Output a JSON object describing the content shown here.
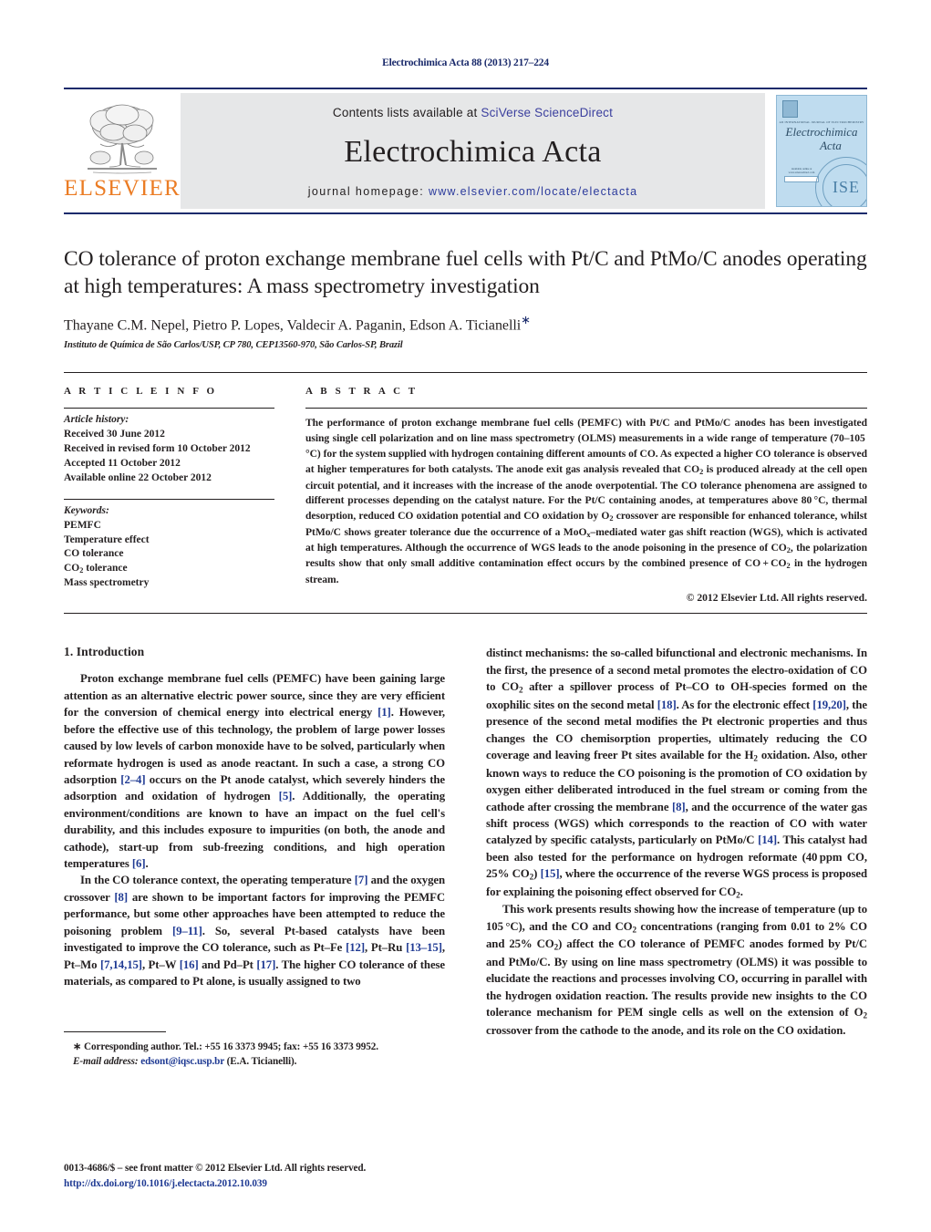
{
  "running_head": "Electrochimica Acta 88 (2013) 217–224",
  "masthead": {
    "publisher_name": "ELSEVIER",
    "contents_prefix": "Contents lists available at ",
    "contents_link": "SciVerse ScienceDirect",
    "journal_title": "Electrochimica Acta",
    "homepage_label": "journal homepage:",
    "homepage_url": "www.elsevier.com/locate/electacta",
    "cover": {
      "kicker": "AN INTERNATIONAL JOURNAL OF ELECTROCHEMISTRY",
      "title_line1": "Electrochimica",
      "title_line2": "Acta",
      "sciencedirect_caption": "Available online at www.sciencedirect.com",
      "sciencedirect_label": "ScienceDirect",
      "seal_text": "ISE"
    },
    "link_color": "#3b3f9e",
    "rule_color": "#1a2a6b",
    "elsevier_orange": "#eb7c24",
    "cover_blue": "#bfdcef"
  },
  "article": {
    "title": "CO tolerance of proton exchange membrane fuel cells with Pt/C and PtMo/C anodes operating at high temperatures: A mass spectrometry investigation",
    "authors": "Thayane C.M. Nepel, Pietro P. Lopes, Valdecir A. Paganin, Edson A. Ticianelli",
    "corresponding_marker": "∗",
    "affiliation": "Instituto de Química de São Carlos/USP, CP 780, CEP13560-970, São Carlos-SP, Brazil"
  },
  "article_info": {
    "heading": "A R T I C L E   I N F O",
    "history_label": "Article history:",
    "history": [
      "Received 30 June 2012",
      "Received in revised form 10 October 2012",
      "Accepted 11 October 2012",
      "Available online 22 October 2012"
    ],
    "keywords_label": "Keywords:",
    "keywords": [
      "PEMFC",
      "Temperature effect",
      "CO tolerance",
      "CO2 tolerance",
      "Mass spectrometry"
    ]
  },
  "abstract": {
    "heading": "A B S T R A C T",
    "text_html": "The performance of proton exchange membrane fuel cells (PEMFC) with Pt/C and PtMo/C anodes has been investigated using single cell polarization and on line mass spectrometry (OLMS) measurements in a wide range of temperature (70–105&#8201;°C) for the system supplied with hydrogen containing different amounts of CO. As expected a higher CO tolerance is observed at higher temperatures for both catalysts. The anode exit gas analysis revealed that CO<sub>2</sub> is produced already at the cell open circuit potential, and it increases with the increase of the anode overpotential. The CO tolerance phenomena are assigned to different processes depending on the catalyst nature. For the Pt/C containing anodes, at temperatures above 80&#8201;°C, thermal desorption, reduced CO oxidation potential and CO oxidation by O<sub>2</sub> crossover are responsible for enhanced tolerance, whilst PtMo/C shows greater tolerance due the occurrence of a MoO<sub>x</sub>–mediated water gas shift reaction (WGS), which is activated at high temperatures. Although the occurrence of WGS leads to the anode poisoning in the presence of CO<sub>2</sub>, the polarization results show that only small additive contamination effect occurs by the combined presence of CO&#8201;+&#8201;CO<sub>2</sub> in the hydrogen stream.",
    "copyright": "© 2012 Elsevier Ltd. All rights reserved."
  },
  "introduction": {
    "number_and_title": "1. Introduction",
    "paragraphs_left_html": [
      "Proton exchange membrane fuel cells (PEMFC) have been gaining large attention as an alternative electric power source, since they are very efficient for the conversion of chemical energy into electrical energy <span class=\"ref\">[1]</span>. However, before the effective use of this technology, the problem of large power losses caused by low levels of carbon monoxide have to be solved, particularly when reformate hydrogen is used as anode reactant. In such a case, a strong CO adsorption <span class=\"ref\">[2–4]</span> occurs on the Pt anode catalyst, which severely hinders the adsorption and oxidation of hydrogen <span class=\"ref\">[5]</span>. Additionally, the operating environment/conditions are known to have an impact on the fuel cell's durability, and this includes exposure to impurities (on both, the anode and cathode), start-up from sub-freezing conditions, and high operation temperatures <span class=\"ref\">[6]</span>.",
      "In the CO tolerance context, the operating temperature <span class=\"ref\">[7]</span> and the oxygen crossover <span class=\"ref\">[8]</span> are shown to be important factors for improving the PEMFC performance, but some other approaches have been attempted to reduce the poisoning problem <span class=\"ref\">[9–11]</span>. So, several Pt-based catalysts have been investigated to improve the CO tolerance, such as Pt–Fe <span class=\"ref\">[12]</span>, Pt–Ru <span class=\"ref\">[13–15]</span>, Pt–Mo <span class=\"ref\">[7,14,15]</span>, Pt–W <span class=\"ref\">[16]</span> and Pd–Pt <span class=\"ref\">[17]</span>. The higher CO tolerance of these materials, as compared to Pt alone, is usually assigned to two"
    ],
    "paragraphs_right_html": [
      "distinct mechanisms: the so-called bifunctional and electronic mechanisms. In the first, the presence of a second metal promotes the electro-oxidation of CO to CO<sub>2</sub> after a spillover process of Pt–CO to OH-species formed on the oxophilic sites on the second metal <span class=\"ref\">[18]</span>. As for the electronic effect <span class=\"ref\">[19,20]</span>, the presence of the second metal modifies the Pt electronic properties and thus changes the CO chemisorption properties, ultimately reducing the CO coverage and leaving freer Pt sites available for the H<sub>2</sub> oxidation. Also, other known ways to reduce the CO poisoning is the promotion of CO oxidation by oxygen either deliberated introduced in the fuel stream or coming from the cathode after crossing the membrane <span class=\"ref\">[8]</span>, and the occurrence of the water gas shift process (WGS) which corresponds to the reaction of CO with water catalyzed by specific catalysts, particularly on PtMo/C <span class=\"ref\">[14]</span>. This catalyst had been also tested for the performance on hydrogen reformate (40&#8201;ppm CO, 25% CO<sub>2</sub>) <span class=\"ref\">[15]</span>, where the occurrence of the reverse WGS process is proposed for explaining the poisoning effect observed for CO<sub>2</sub>.",
      "This work presents results showing how the increase of temperature (up to 105&#8201;°C), and the CO and CO<sub>2</sub> concentrations (ranging from 0.01 to 2% CO and 25% CO<sub>2</sub>) affect the CO tolerance of PEMFC anodes formed by Pt/C and PtMo/C. By using on line mass spectrometry (OLMS) it was possible to elucidate the reactions and processes involving CO, occurring in parallel with the hydrogen oxidation reaction. The results provide new insights to the CO tolerance mechanism for PEM single cells as well on the extension of O<sub>2</sub> crossover from the cathode to the anode, and its role on the CO oxidation."
    ]
  },
  "footnote": {
    "corresponding_html": "<span class=\"marker\">∗</span> Corresponding author. Tel.: +55 16 3373 9945; fax: +55 16 3373 9952.",
    "email_label": "E-mail address:",
    "email": "edsont@iqsc.usp.br",
    "email_owner": "(E.A. Ticianelli)."
  },
  "imprint": {
    "line1": "0013-4686/$ – see front matter © 2012 Elsevier Ltd. All rights reserved.",
    "doi": "http://dx.doi.org/10.1016/j.electacta.2012.10.039"
  }
}
